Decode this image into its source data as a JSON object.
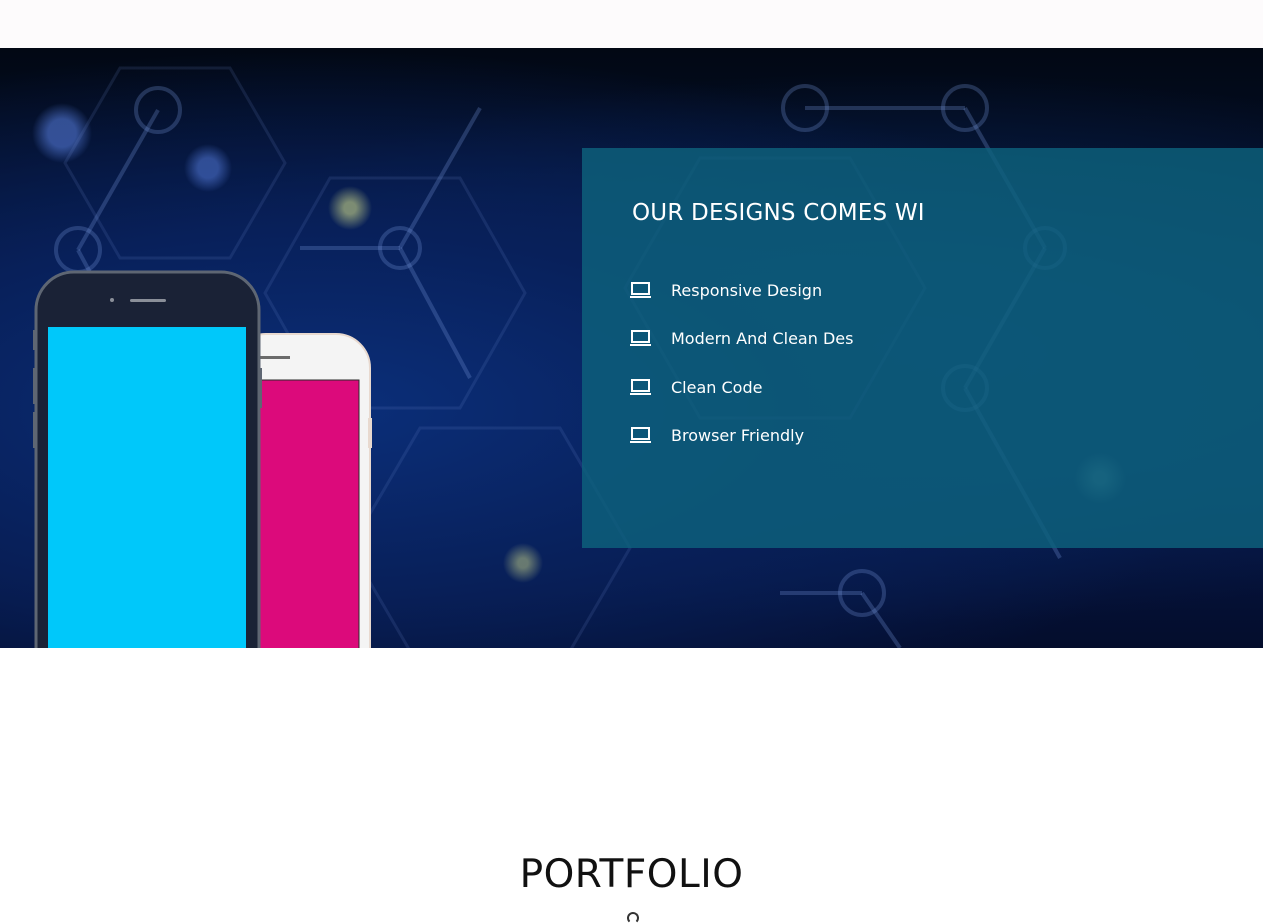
{
  "hero": {
    "heading": "OUR DESIGNS COMES WI",
    "features": [
      {
        "icon": "laptop-icon",
        "label": "Responsive Design"
      },
      {
        "icon": "laptop-icon",
        "label": "Modern And Clean Des"
      },
      {
        "icon": "laptop-icon",
        "label": "Clean Code"
      },
      {
        "icon": "laptop-icon",
        "label": "Browser Friendly"
      }
    ]
  },
  "portfolio": {
    "title": "PORTFOLIO"
  },
  "colors": {
    "panel": "#0e627d",
    "phone_front_screen": "#00c8fa",
    "phone_back_screen": "#dc0a7b",
    "phone_front_body": "#1a2236",
    "phone_back_body": "#f4f4f4"
  }
}
